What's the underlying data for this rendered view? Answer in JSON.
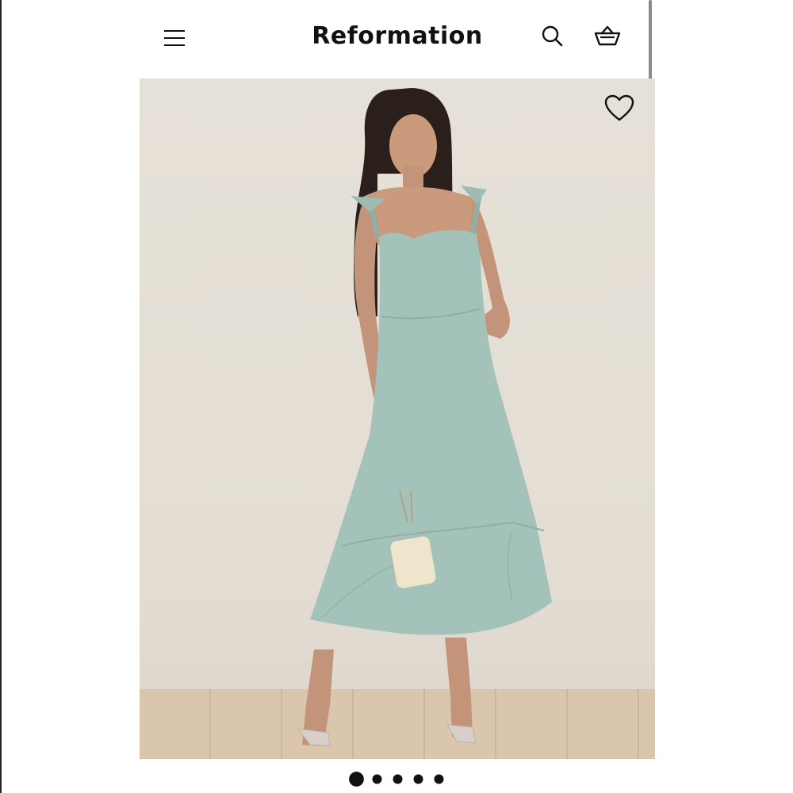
{
  "brand": "Reformation",
  "header": {
    "menu_icon": "hamburger-menu-icon",
    "search_icon": "search-icon",
    "cart_icon": "shopping-basket-icon"
  },
  "product_image": {
    "favorite_icon": "heart-outline-icon",
    "dress_color": "#a3c2b9"
  },
  "carousel": {
    "slide_count": 5,
    "active_index": 0
  }
}
